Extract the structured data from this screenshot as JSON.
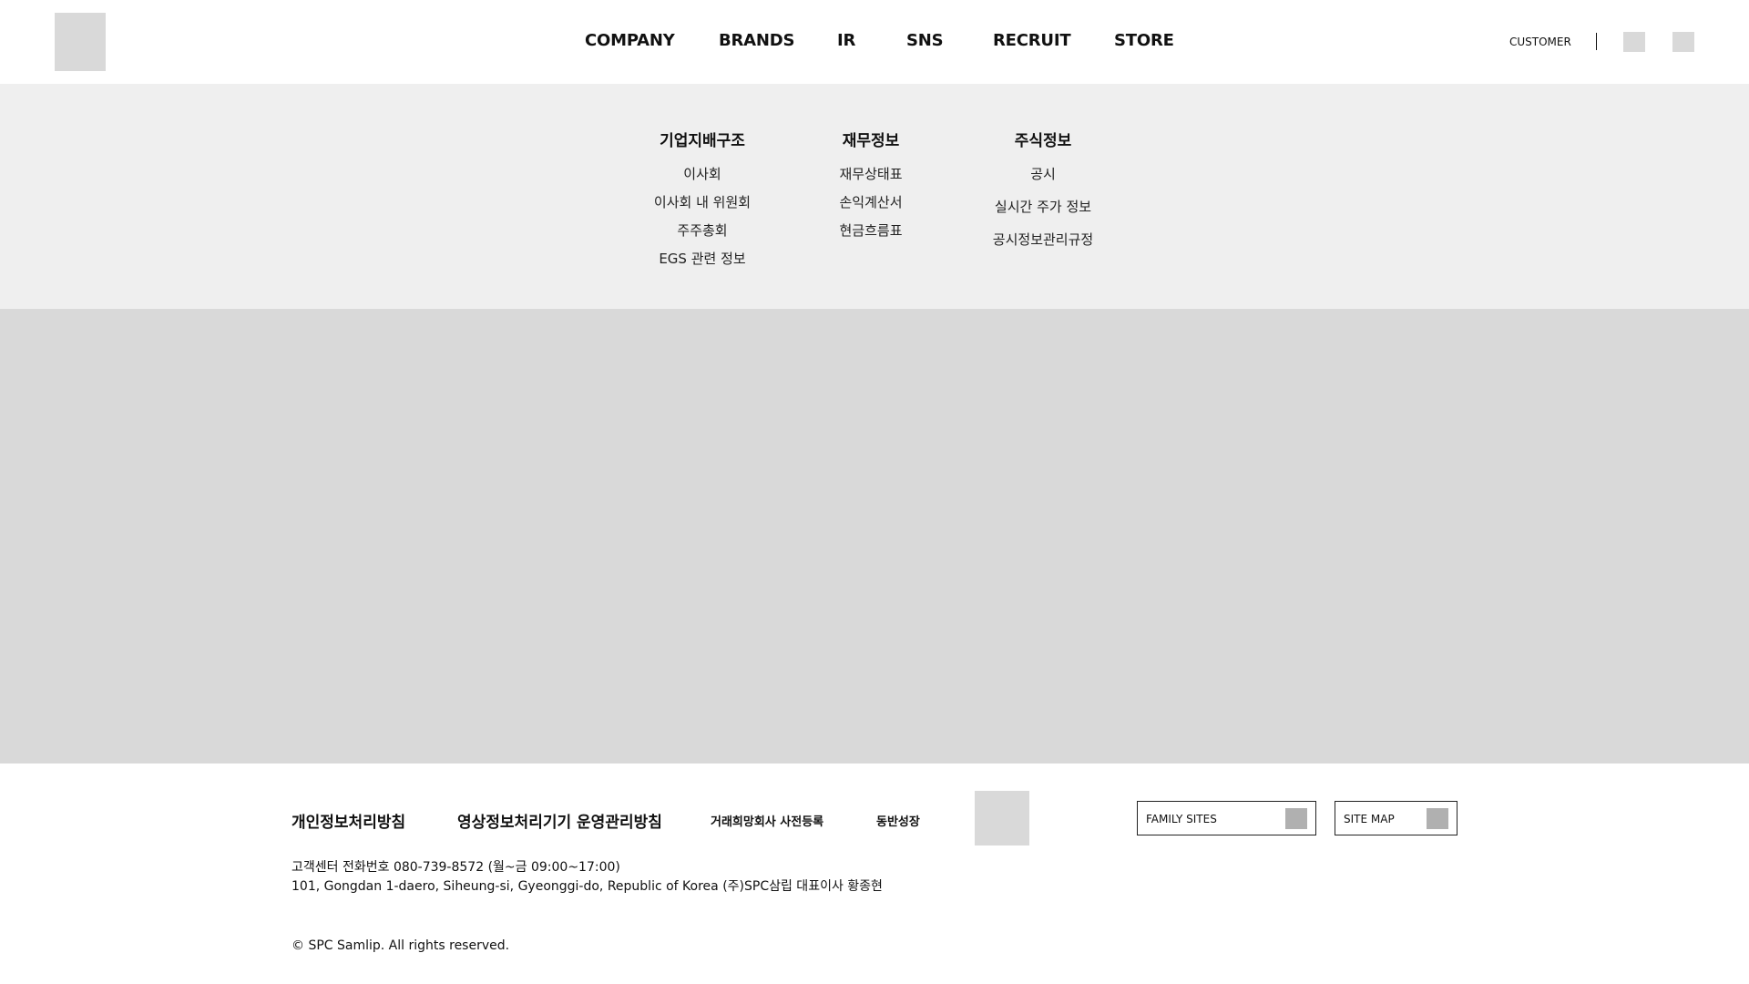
{
  "header": {
    "nav": [
      "COMPANY",
      "BRANDS",
      "IR",
      "SNS",
      "RECRUIT",
      "STORE"
    ],
    "customer_label": "CUSTOMER"
  },
  "mega_menu": {
    "columns": [
      {
        "title": "기업지배구조",
        "items": [
          "이사회",
          "이사회 내 위원회",
          "주주총회",
          "EGS 관련 정보"
        ]
      },
      {
        "title": "재무정보",
        "items": [
          "재무상태표",
          "손익계산서",
          "현금흐름표"
        ]
      },
      {
        "title": "주식정보",
        "items": [
          "공시",
          "실시간 주가 정보",
          "공시정보관리규정"
        ]
      }
    ]
  },
  "footer": {
    "links": [
      "개인정보처리방침",
      "영상정보처리기기 운영관리방침",
      "거래희망회사 사전등록",
      "동반성장"
    ],
    "family_sites_label": "FAMILY SITES",
    "site_map_label": "SITE MAP",
    "contact_line": "고객센터  전화번호 080-739-8572 (월~금 09:00~17:00)",
    "address_line": "101, Gongdan 1-daero, Siheung-si, Gyeonggi-do, Republic of Korea (주)SPC삼립 대표이사 황종현",
    "copyright": "© SPC Samlip. All rights reserved."
  }
}
